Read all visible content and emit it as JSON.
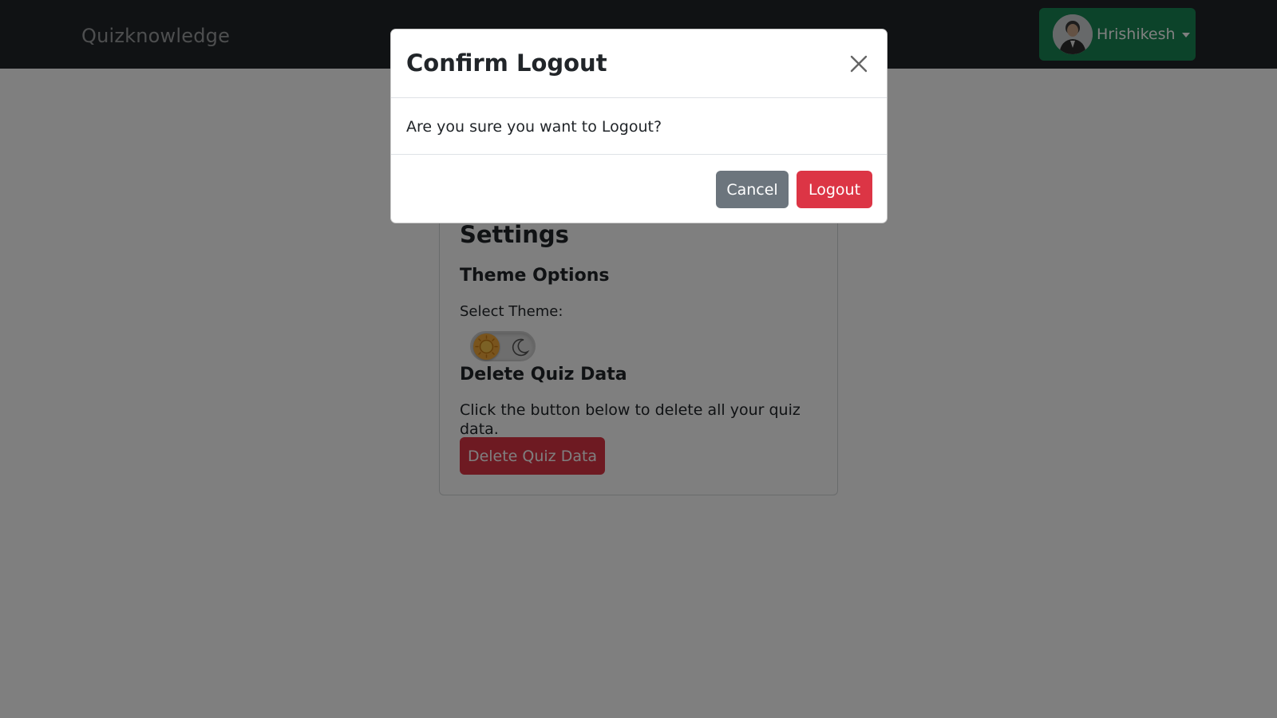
{
  "navbar": {
    "brand": "Quizknowledge",
    "user_name": "Hrishikesh"
  },
  "settings": {
    "title": "Settings",
    "theme_heading": "Theme Options",
    "theme_label": "Select Theme:",
    "theme_toggle": {
      "state": "light",
      "light_icon": "sun-icon",
      "dark_icon": "moon-icon"
    },
    "delete_heading": "Delete Quiz Data",
    "delete_text": "Click the button below to delete all your quiz data.",
    "delete_button": "Delete Quiz Data"
  },
  "modal": {
    "title": "Confirm Logout",
    "message": "Are you sure you want to Logout?",
    "cancel_label": "Cancel",
    "logout_label": "Logout"
  },
  "colors": {
    "navbar_bg": "#212529",
    "success": "#198754",
    "danger": "#dc3545",
    "secondary": "#6c757d"
  }
}
